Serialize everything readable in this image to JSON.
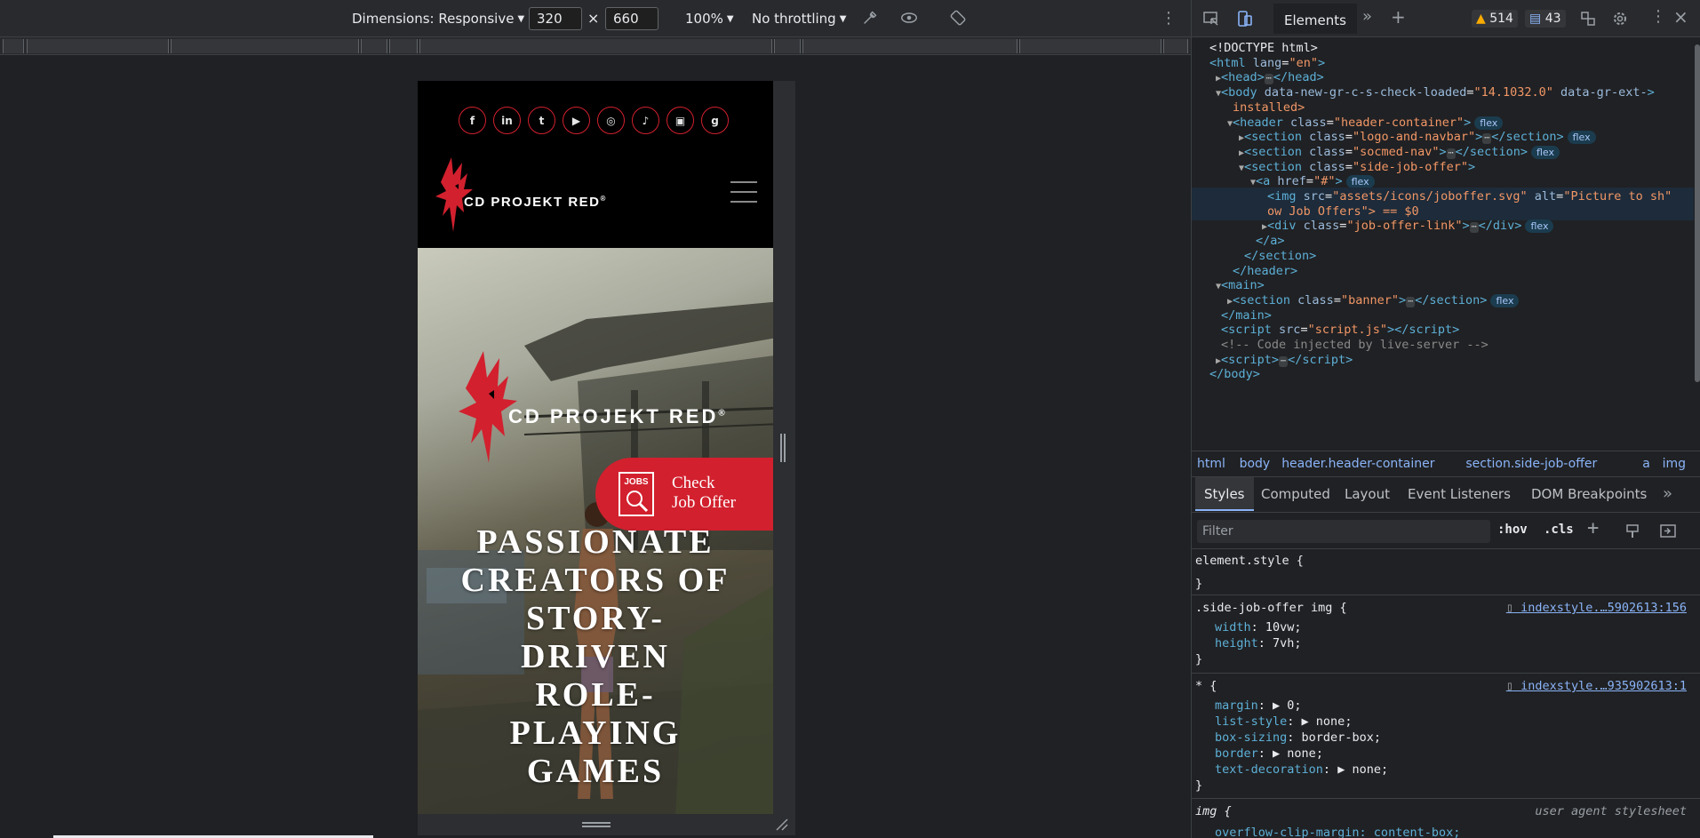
{
  "device_toolbar": {
    "dimensions_label": "Dimensions: Responsive",
    "width": "320",
    "times": "×",
    "height": "660",
    "zoom": "100%",
    "throttling": "No throttling"
  },
  "site": {
    "social_icons": [
      "facebook-icon",
      "linkedin-icon",
      "twitter-icon",
      "youtube-icon",
      "instagram-icon",
      "tiktok-icon",
      "twitch-icon",
      "gog-icon"
    ],
    "social_glyphs": [
      "f",
      "in",
      "t",
      "▶",
      "◎",
      "♪",
      "▣",
      "g"
    ],
    "logo_text": "CD PROJEKT RED",
    "registered": "®",
    "job_offer": {
      "badge": "JOBS",
      "line1": "Check",
      "line2": "Job Offer"
    },
    "headline_lines": [
      "PASSIONATE",
      "CREATORS OF",
      "STORY-",
      "DRIVEN",
      "ROLE-",
      "PLAYING",
      "GAMES"
    ]
  },
  "devtools": {
    "tab_active": "Elements",
    "warnings": "514",
    "messages": "43",
    "dom": [
      {
        "indent": 0,
        "tri": "",
        "html": "doctype",
        "text": "<!DOCTYPE html>"
      },
      {
        "indent": 0,
        "tri": "",
        "tag": "html",
        "attrs": [
          [
            "lang",
            "en"
          ]
        ],
        "close": false
      },
      {
        "indent": 1,
        "tri": "▶",
        "tag": "head",
        "collapsed": true
      },
      {
        "indent": 1,
        "tri": "▼",
        "tag": "body",
        "attrs": [
          [
            "data-new-gr-c-s-check-loaded",
            "14.1032.0"
          ],
          [
            "data-gr-ext-",
            ""
          ]
        ]
      },
      {
        "indent": 2,
        "tri": "",
        "text_only": "installed>"
      },
      {
        "indent": 2,
        "tri": "▼",
        "tag": "header",
        "attrs": [
          [
            "class",
            "header-container"
          ]
        ],
        "pill": "flex"
      },
      {
        "indent": 3,
        "tri": "▶",
        "tag": "section",
        "attrs": [
          [
            "class",
            "logo-and-navbar"
          ]
        ],
        "collapsed": true,
        "pill": "flex"
      },
      {
        "indent": 3,
        "tri": "▶",
        "tag": "section",
        "attrs": [
          [
            "class",
            "socmed-nav"
          ]
        ],
        "collapsed": true,
        "pill": "flex"
      },
      {
        "indent": 3,
        "tri": "▼",
        "tag": "section",
        "attrs": [
          [
            "class",
            "side-job-offer"
          ]
        ]
      },
      {
        "indent": 4,
        "tri": "▼",
        "tag": "a",
        "attrs": [
          [
            "href",
            "#"
          ]
        ],
        "pill": "flex"
      },
      {
        "indent": 5,
        "tri": "",
        "tag": "img",
        "attrs": [
          [
            "src",
            "assets/icons/joboffer.svg"
          ],
          [
            "alt",
            "Picture to sh"
          ]
        ],
        "selected": true
      },
      {
        "indent": 5,
        "tri": "",
        "text_only": "ow Job Offers\"> == $0",
        "selected": true
      },
      {
        "indent": 5,
        "tri": "▶",
        "tag": "div",
        "attrs": [
          [
            "class",
            "job-offer-link"
          ]
        ],
        "collapsed": true,
        "pill": "flex"
      },
      {
        "indent": 4,
        "tri": "",
        "closing": "a"
      },
      {
        "indent": 3,
        "tri": "",
        "closing": "section"
      },
      {
        "indent": 2,
        "tri": "",
        "closing": "header"
      },
      {
        "indent": 1,
        "tri": "▼",
        "tag": "main"
      },
      {
        "indent": 2,
        "tri": "▶",
        "tag": "section",
        "attrs": [
          [
            "class",
            "banner"
          ]
        ],
        "collapsed": true,
        "pill": "flex"
      },
      {
        "indent": 1,
        "tri": "",
        "closing": "main"
      },
      {
        "indent": 1,
        "tri": "",
        "tag": "script",
        "attrs": [
          [
            "src",
            "script.js"
          ]
        ],
        "inline_close": true
      },
      {
        "indent": 1,
        "tri": "",
        "comment": "<!-- Code injected by live-server -->"
      },
      {
        "indent": 1,
        "tri": "▶",
        "tag": "script",
        "collapsed": true
      },
      {
        "indent": 0,
        "tri": "",
        "closing": "body"
      }
    ],
    "breadcrumbs": [
      "html",
      "body",
      "header.header-container",
      "section.side-job-offer",
      "a",
      "img"
    ],
    "style_tabs": [
      "Styles",
      "Computed",
      "Layout",
      "Event Listeners",
      "DOM Breakpoints"
    ],
    "filter_placeholder": "Filter",
    "hov": ":hov",
    "cls": ".cls",
    "rules": {
      "element_style": "element.style {",
      "close_brace": "}",
      "r1_selector": ".side-job-offer img {",
      "r1_src": "indexstyle.…5902613:156",
      "r1_props": [
        [
          "width",
          "10vw;"
        ],
        [
          "height",
          "7vh;"
        ]
      ],
      "r2_selector": "* {",
      "r2_src": "indexstyle.…935902613:1",
      "r2_props": [
        [
          "margin",
          "▶ 0;"
        ],
        [
          "list-style",
          "▶ none;"
        ],
        [
          "box-sizing",
          "border-box;"
        ],
        [
          "border",
          "▶ none;"
        ],
        [
          "text-decoration",
          "▶ none;"
        ]
      ],
      "r3_selector": "img {",
      "r3_src": "user agent stylesheet",
      "r3_partial": "overflow-clip-margin: content-box;"
    }
  }
}
